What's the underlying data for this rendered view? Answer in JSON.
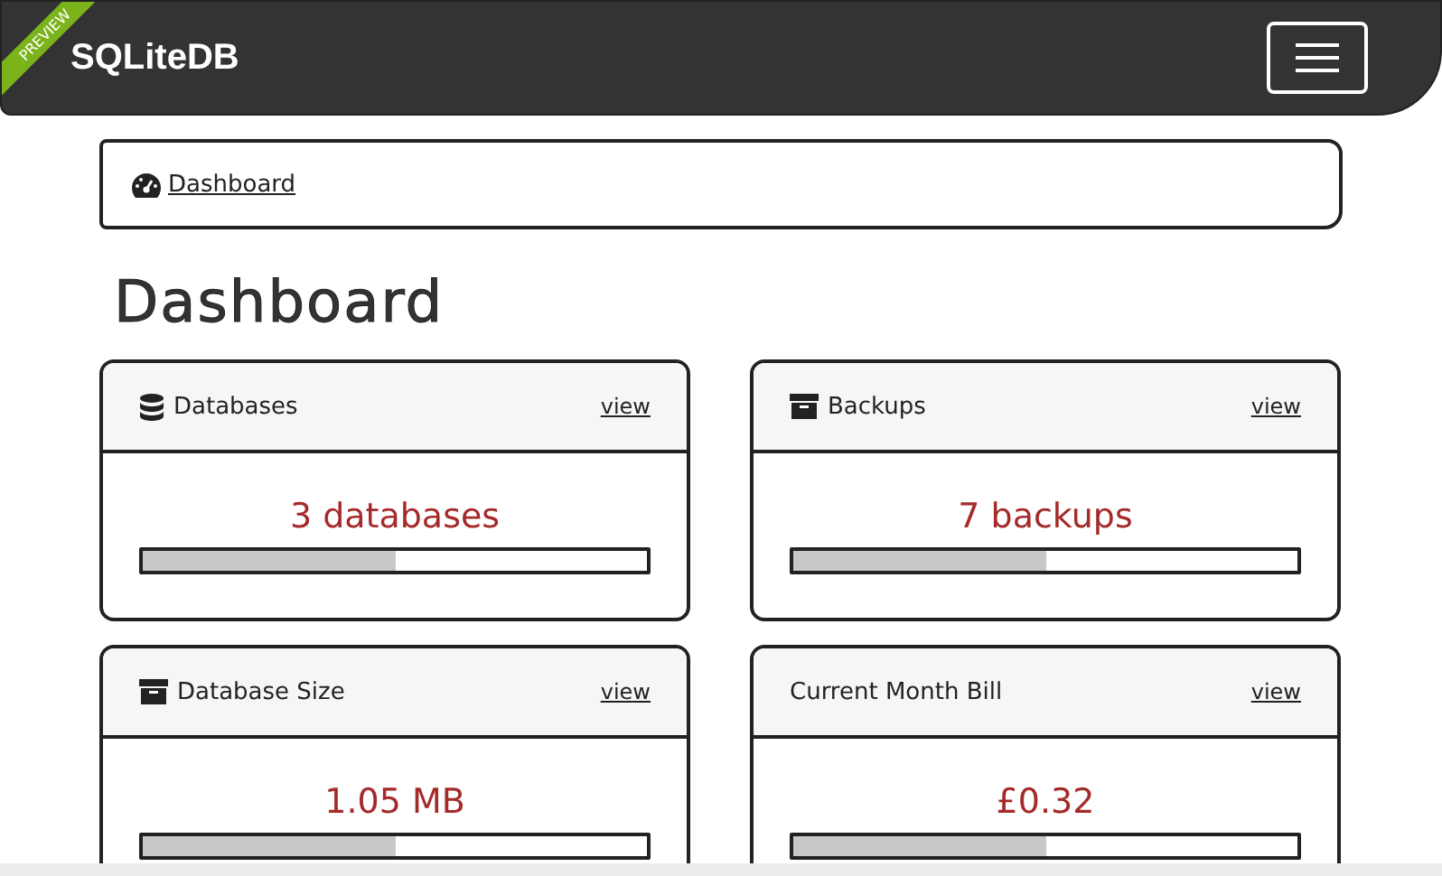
{
  "navbar": {
    "ribbon": "PREVIEW",
    "brand": "SQLiteDB"
  },
  "breadcrumb": {
    "label": "Dashboard"
  },
  "title": "Dashboard",
  "cards": [
    {
      "kind": "database",
      "title": "Databases",
      "link": "view",
      "value": "3 databases",
      "level": 0.5
    },
    {
      "kind": "archive",
      "title": "Backups",
      "link": "view",
      "value": "7 backups",
      "level": 0.5
    },
    {
      "kind": "archive",
      "title": "Database Size",
      "link": "view",
      "value": "1.05 MB",
      "level": 0.5
    },
    {
      "kind": "plain",
      "title": "Current Month Bill",
      "link": "view",
      "value": "£0.32",
      "level": 0.5
    }
  ]
}
